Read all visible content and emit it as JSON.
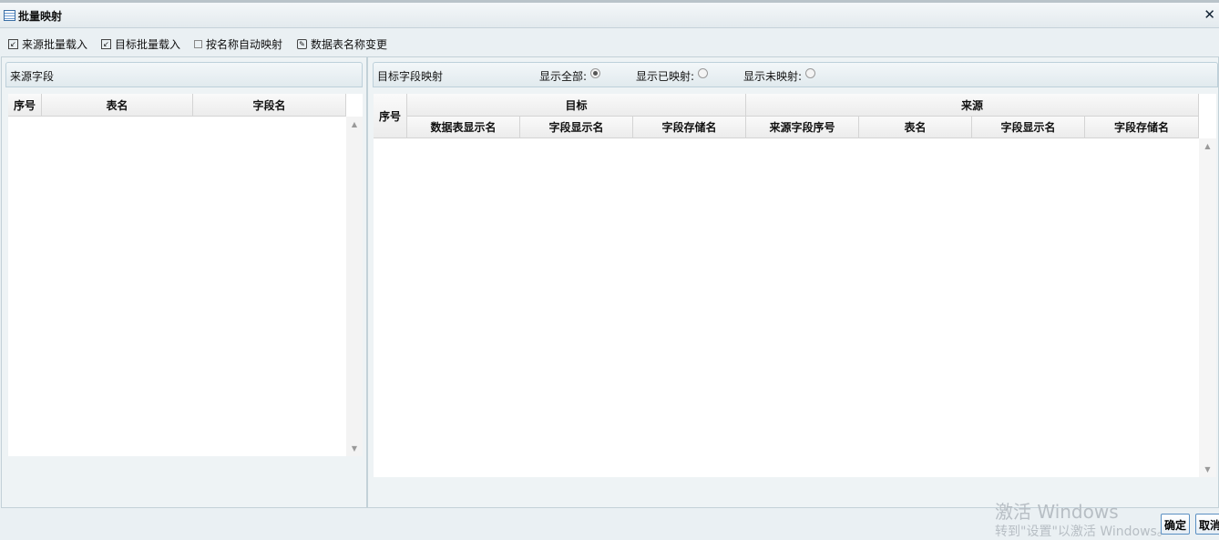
{
  "window": {
    "title": "批量映射"
  },
  "toolbar": [
    "来源批量载入",
    "目标批量载入",
    "按名称自动映射",
    "数据表名称变更"
  ],
  "source_panel": {
    "title": "来源字段",
    "columns": [
      "序号",
      "表名",
      "字段名"
    ]
  },
  "target_panel": {
    "title": "目标字段映射",
    "filters": [
      {
        "label": "显示全部:",
        "checked": true
      },
      {
        "label": "显示已映射:",
        "checked": false
      },
      {
        "label": "显示未映射:",
        "checked": false
      }
    ],
    "index_col": "序号",
    "groups": [
      "目标",
      "来源"
    ],
    "columns": [
      "数据表显示名",
      "字段显示名",
      "字段存储名",
      "来源字段序号",
      "表名",
      "字段显示名",
      "字段存储名"
    ]
  },
  "footer": {
    "ok": "确定",
    "cancel": "取消"
  },
  "watermark": {
    "line1": "激活 Windows",
    "line2": "转到\"设置\"以激活 Windows。"
  }
}
